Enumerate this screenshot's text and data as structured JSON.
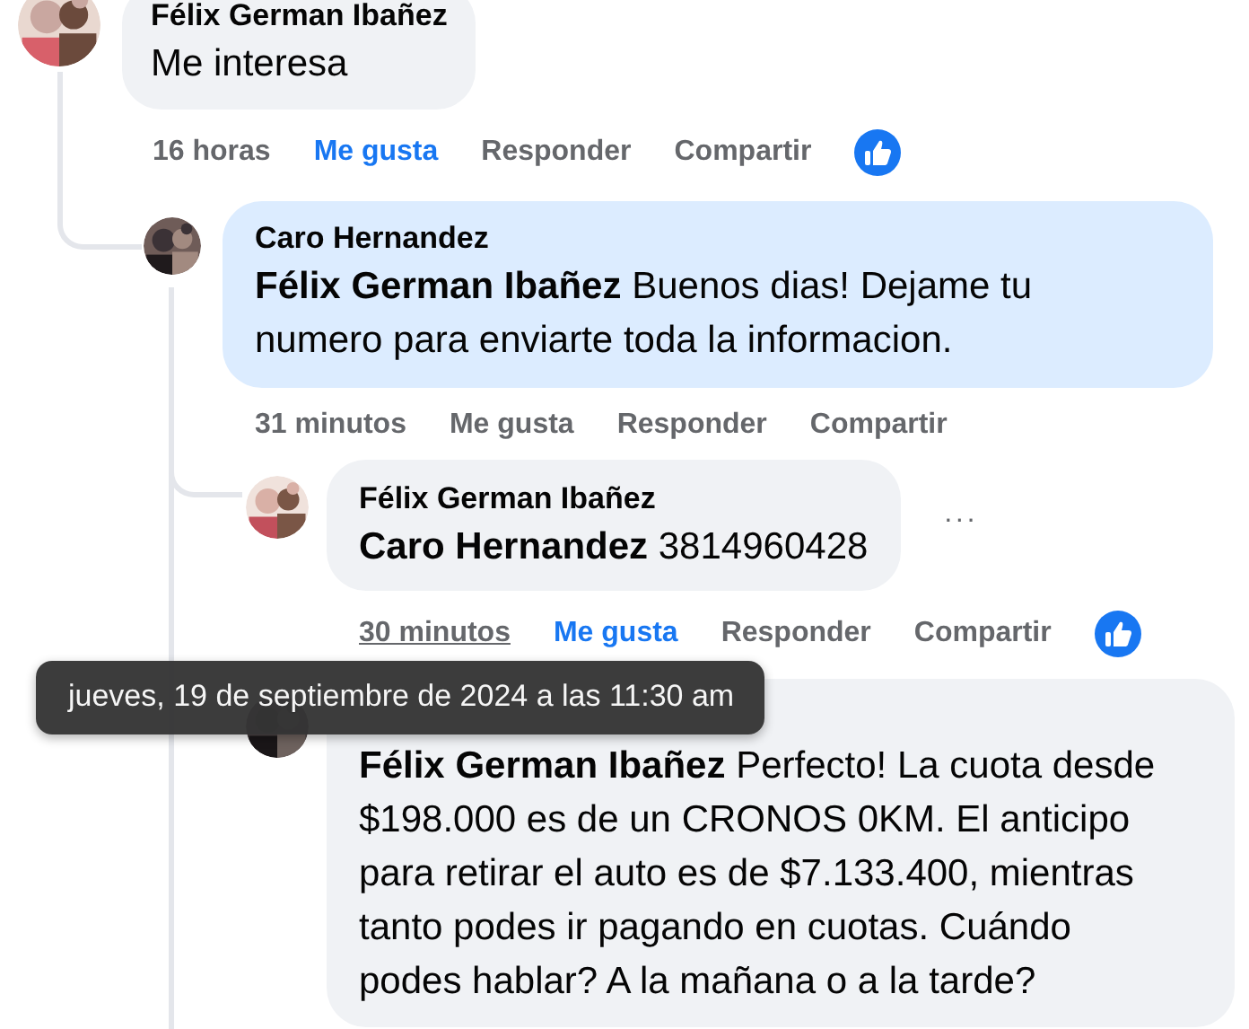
{
  "comments": [
    {
      "author": "Félix German Ibañez",
      "text": "Me interesa",
      "time": "16 horas",
      "time_hovered": false,
      "liked": true,
      "has_reaction": true,
      "like": "Me gusta",
      "reply": "Responder",
      "share": "Compartir",
      "highlighted": false
    },
    {
      "author": "Caro Hernandez",
      "text": "**Félix German Ibañez** Buenos dias! Dejame tu numero para enviarte toda la informacion.",
      "time": "31 minutos",
      "time_hovered": false,
      "liked": false,
      "has_reaction": false,
      "like": "Me gusta",
      "reply": "Responder",
      "share": "Compartir",
      "highlighted": true
    },
    {
      "author": "Félix German Ibañez",
      "text": "**Caro Hernandez** 3814960428",
      "time": "30 minutos",
      "time_hovered": true,
      "liked": true,
      "has_reaction": true,
      "like": "Me gusta",
      "reply": "Responder",
      "share": "Compartir",
      "more_label": "···",
      "highlighted": false
    },
    {
      "text": "**Félix German Ibañez** Perfecto! La cuota desde $198.000 es de un CRONOS 0KM. El anticipo para retirar el auto es de $7.133.400, mientras tanto podes ir pagando en cuotas. Cuándo podes hablar? A la mañana o a la tarde?",
      "highlighted": false
    }
  ],
  "tooltip": {
    "text": "jueves, 19 de septiembre de 2024 a las 11:30 am"
  }
}
